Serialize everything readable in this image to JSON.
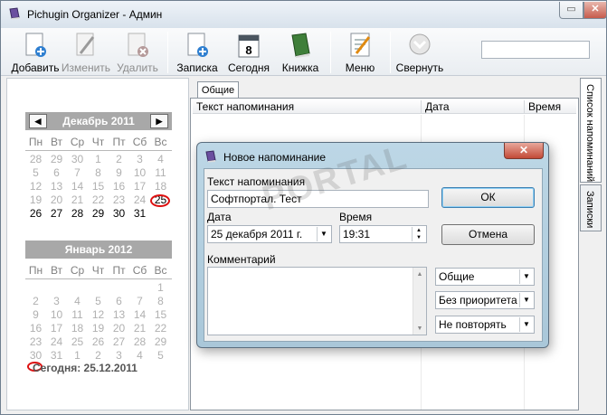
{
  "window": {
    "title": "Pichugin Organizer - Админ",
    "minimize_glyph": "▭",
    "close_glyph": "✕"
  },
  "toolbar": {
    "add": "Добавить",
    "edit": "Изменить",
    "delete": "Удалить",
    "note": "Записка",
    "today": "Сегодня",
    "book": "Книжка",
    "menu": "Меню",
    "collapse": "Свернуть",
    "today_icon_number": "8",
    "search_value": ""
  },
  "calendar": {
    "weekdays": [
      "Пн",
      "Вт",
      "Ср",
      "Чт",
      "Пт",
      "Сб",
      "Вс"
    ],
    "prev_glyph": "◀",
    "next_glyph": "▶",
    "month1": {
      "title": "Декабрь 2011",
      "days": [
        [
          "28",
          "29",
          "30",
          "1",
          "2",
          "3",
          "4"
        ],
        [
          "5",
          "6",
          "7",
          "8",
          "9",
          "10",
          "11"
        ],
        [
          "12",
          "13",
          "14",
          "15",
          "16",
          "17",
          "18"
        ],
        [
          "19",
          "20",
          "21",
          "22",
          "23",
          "24",
          "25"
        ],
        [
          "26",
          "27",
          "28",
          "29",
          "30",
          "31",
          ""
        ]
      ]
    },
    "month2": {
      "title": "Январь 2012",
      "days": [
        [
          "",
          "",
          "",
          "",
          "",
          "",
          "1"
        ],
        [
          "2",
          "3",
          "4",
          "5",
          "6",
          "7",
          "8"
        ],
        [
          "9",
          "10",
          "11",
          "12",
          "13",
          "14",
          "15"
        ],
        [
          "16",
          "17",
          "18",
          "19",
          "20",
          "21",
          "22"
        ],
        [
          "23",
          "24",
          "25",
          "26",
          "27",
          "28",
          "29"
        ],
        [
          "30",
          "31",
          "1",
          "2",
          "3",
          "4",
          "5"
        ]
      ]
    },
    "today_text": "Сегодня: 25.12.2011"
  },
  "main": {
    "tab": "Общие",
    "columns": [
      "Текст напоминания",
      "Дата",
      "Время"
    ]
  },
  "side_tabs": {
    "reminders": "Список напоминаний",
    "notes": "Записки"
  },
  "dialog": {
    "title": "Новое напоминание",
    "close_glyph": "✕",
    "text_label": "Текст напоминания",
    "text_value": "Софтпортал. Тест",
    "date_label": "Дата",
    "date_value": "25 декабря  2011 г.",
    "time_label": "Время",
    "time_value": "19:31",
    "comment_label": "Комментарий",
    "comment_value": "",
    "ok": "ОК",
    "cancel": "Отмена",
    "category": "Общие",
    "priority": "Без приоритета",
    "repeat": "Не повторять"
  },
  "watermark_text": "PORTAL"
}
